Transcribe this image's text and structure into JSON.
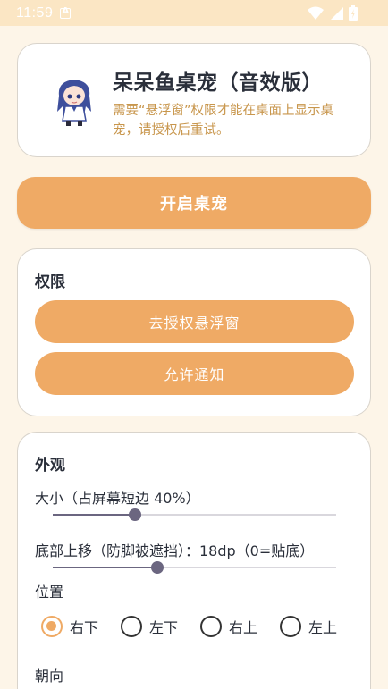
{
  "status_bar": {
    "time": "11:59"
  },
  "header": {
    "title": "呆呆鱼桌宠（音效版）",
    "note": "需要“悬浮窗”权限才能在桌面上显示桌宠，请授权后重试。"
  },
  "main_button": "开启桌宠",
  "permissions": {
    "title": "权限",
    "overlay_button": "去授权悬浮窗",
    "notify_button": "允许通知"
  },
  "appearance": {
    "title": "外观",
    "size_label": "大小（占屏幕短边 40%）",
    "size_value": 0.29,
    "offset_label": "底部上移（防脚被遮挡）：18dp（0=贴底）",
    "offset_value": 0.37,
    "position_label": "位置",
    "positions": [
      "右下",
      "左下",
      "右上",
      "左上"
    ],
    "selected_position": "右下",
    "orientation_label": "朝向"
  },
  "colors": {
    "accent": "#efaa65",
    "background": "#fdf5e8",
    "note": "#c8964c",
    "slider": "#6b6680"
  }
}
